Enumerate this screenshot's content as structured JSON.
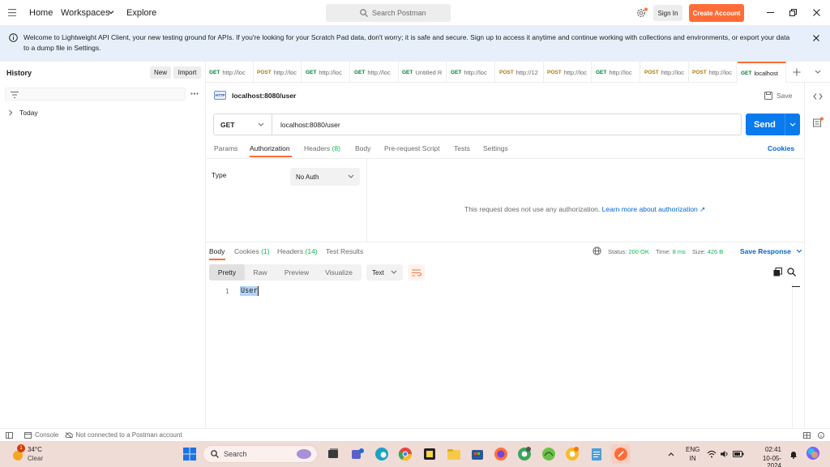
{
  "topbar": {
    "home": "Home",
    "workspaces": "Workspaces",
    "explore": "Explore",
    "search_placeholder": "Search Postman",
    "signin": "Sign In",
    "create": "Create Account"
  },
  "banner": {
    "line1": "Welcome to Lightweight API Client, your new testing ground for APIs. If you're looking for your Scratch Pad data, don't worry; it is safe and secure. Sign up to access it anytime and continue working with collections and environments, or export your data",
    "line2": "to a dump file in Settings."
  },
  "sidebar": {
    "title": "History",
    "new_label": "New",
    "import_label": "Import",
    "group": "Today"
  },
  "tabs": [
    {
      "method": "GET",
      "label": "http://loc"
    },
    {
      "method": "POST",
      "label": "http://loc"
    },
    {
      "method": "GET",
      "label": "http://loc"
    },
    {
      "method": "GET",
      "label": "http://loc"
    },
    {
      "method": "GET",
      "label": "Untitled R"
    },
    {
      "method": "GET",
      "label": "http://loc"
    },
    {
      "method": "POST",
      "label": "http://12"
    },
    {
      "method": "POST",
      "label": "http://loc"
    },
    {
      "method": "GET",
      "label": "http://loc"
    },
    {
      "method": "POST",
      "label": "http://loc"
    },
    {
      "method": "POST",
      "label": "http://loc"
    },
    {
      "method": "GET",
      "label": "localhost"
    }
  ],
  "request": {
    "icon_label": "HTTP",
    "title": "localhost:8080/user",
    "save": "Save",
    "method": "GET",
    "url": "localhost:8080/user",
    "send": "Send"
  },
  "req_tabs": {
    "params": "Params",
    "authorization": "Authorization",
    "headers": "Headers",
    "headers_count": "(8)",
    "body": "Body",
    "prerequest": "Pre-request Script",
    "tests": "Tests",
    "settings": "Settings",
    "cookies": "Cookies"
  },
  "auth": {
    "type_label": "Type",
    "type_value": "No Auth",
    "message": "This request does not use any authorization.",
    "learn_more": "Learn more about authorization ↗"
  },
  "response": {
    "body": "Body",
    "cookies": "Cookies",
    "cookies_count": "(1)",
    "headers": "Headers",
    "headers_count": "(14)",
    "test_results": "Test Results",
    "status_label": "Status:",
    "status_value": "200 OK",
    "time_label": "Time:",
    "time_value": "8 ms",
    "size_label": "Size:",
    "size_value": "426 B",
    "save_response": "Save Response",
    "pretty": "Pretty",
    "raw": "Raw",
    "preview": "Preview",
    "visualize": "Visualize",
    "format": "Text",
    "line_no": "1",
    "line_text": "User"
  },
  "statusbar": {
    "console": "Console",
    "not_connected": "Not connected to a Postman account"
  },
  "taskbar": {
    "weather_temp": "34°C",
    "weather_desc": "Clear",
    "weather_badge": "1",
    "search": "Search",
    "lang1": "ENG",
    "lang2": "IN",
    "time": "02:41",
    "date": "10-05-2024"
  },
  "colors": {
    "accent": "#ff6c37",
    "send": "#097bed",
    "get": "#007f31",
    "post": "#ad7a03",
    "taskbar": "#f0dcd6"
  }
}
